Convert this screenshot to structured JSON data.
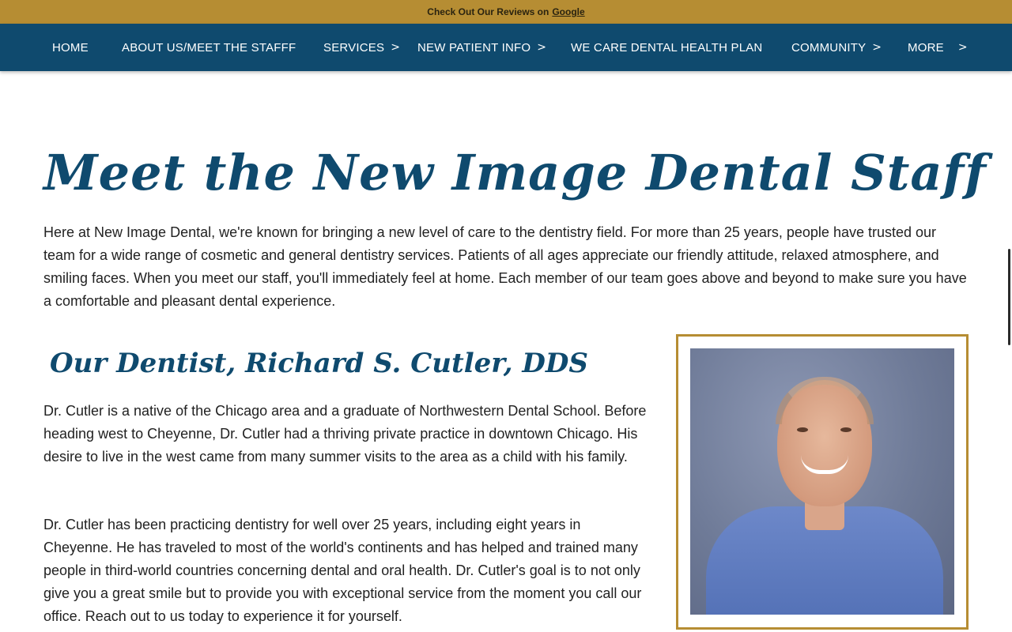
{
  "banner": {
    "text": "Check Out Our Reviews on",
    "link": "Google"
  },
  "nav": {
    "items": [
      {
        "label": "HOME",
        "has_submenu": false
      },
      {
        "label": "ABOUT US/MEET THE STAFFF",
        "has_submenu": false
      },
      {
        "label": "SERVICES",
        "has_submenu": true
      },
      {
        "label": "NEW PATIENT INFO",
        "has_submenu": true
      },
      {
        "label": "WE CARE DENTAL HEALTH PLAN",
        "has_submenu": false
      },
      {
        "label": "COMMUNITY",
        "has_submenu": true
      },
      {
        "label": "MORE",
        "has_submenu": true
      }
    ],
    "chevron": ">"
  },
  "page": {
    "title": "Meet the New Image Dental Staff",
    "intro": "Here at New Image Dental, we're known for bringing a new level of care to the dentistry field. For more than 25 years, people have trusted our team for a wide range of cosmetic and general dentistry services. Patients of all ages appreciate our friendly attitude, relaxed atmosphere, and smiling faces. When you meet our staff, you'll immediately feel at home. Each member of our team goes above and beyond to make sure you have a comfortable and pleasant dental experience."
  },
  "dentist": {
    "heading": "Our Dentist, Richard S. Cutler, DDS",
    "paragraph1": "Dr. Cutler is a native of the Chicago area and a graduate of Northwestern Dental School. Before heading west to Cheyenne, Dr. Cutler had a thriving private practice in downtown Chicago. His desire to live in the west came from many summer visits to the area as a child with his family.",
    "paragraph2": "Dr. Cutler has been practicing dentistry for well over 25 years, including eight years in Cheyenne. He has traveled to most of the world's continents and has helped and trained many people in third-world countries concerning dental and oral health. Dr. Cutler's goal is to not only give you a great smile but to provide you with exceptional service from the moment you call our office. Reach out to us today to experience it for yourself."
  },
  "colors": {
    "banner_gold": "#b68d33",
    "nav_blue": "#0f4a6e",
    "heading_blue": "#0f4a6e",
    "frame_gold": "#b68d33"
  }
}
